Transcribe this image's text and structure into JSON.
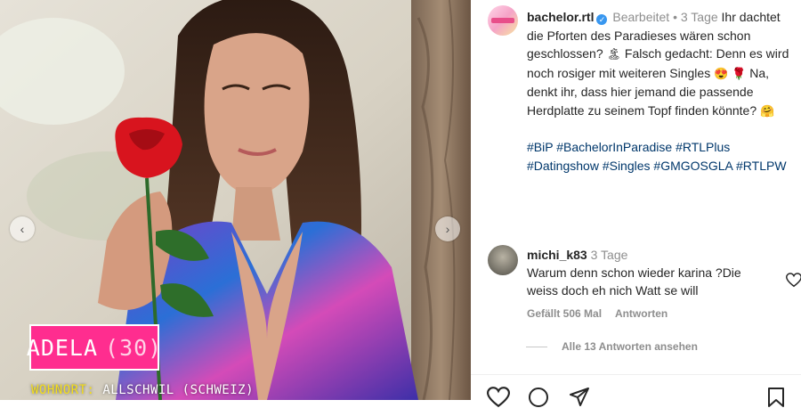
{
  "image": {
    "badge_name": "ADELA",
    "badge_age": "(30)",
    "location_label": "WOHNORT:",
    "location_value": "ALLSCHWIL (SCHWEIZ)",
    "nav_prev": "‹",
    "nav_next": "›"
  },
  "post": {
    "username": "bachelor.rtl",
    "verified_mark": "✓",
    "edited": "Bearbeitet",
    "separator": "•",
    "time": "3 Tage",
    "caption_1": "Ihr dachtet die Pforten des Paradieses wären schon geschlossen?",
    "emoji_1": "🏝",
    "caption_2": "Falsch gedacht: Denn es wird noch rosiger mit weiteren Singles",
    "emoji_2": "😍",
    "emoji_3": "🌹",
    "caption_3": "Na, denkt ihr, dass hier jemand die passende Herdplatte zu seinem Topf finden könnte?",
    "emoji_4": "🤗",
    "hashtags": "#BiP #BachelorInParadise #RTLPlus #Datingshow #Singles #GMGOSGLA #RTLPW"
  },
  "comment": {
    "username": "michi_k83",
    "time": "3 Tage",
    "text": "Warum denn schon wieder karina ?Die weiss doch eh nich Watt se will",
    "likes": "Gefällt 506 Mal",
    "reply": "Antworten",
    "view_replies": "Alle 13 Antworten ansehen"
  },
  "colors": {
    "badge": "#ff2d8f",
    "location_label": "#f4de1c",
    "hashtag": "#00376b",
    "verified": "#3897f0"
  }
}
